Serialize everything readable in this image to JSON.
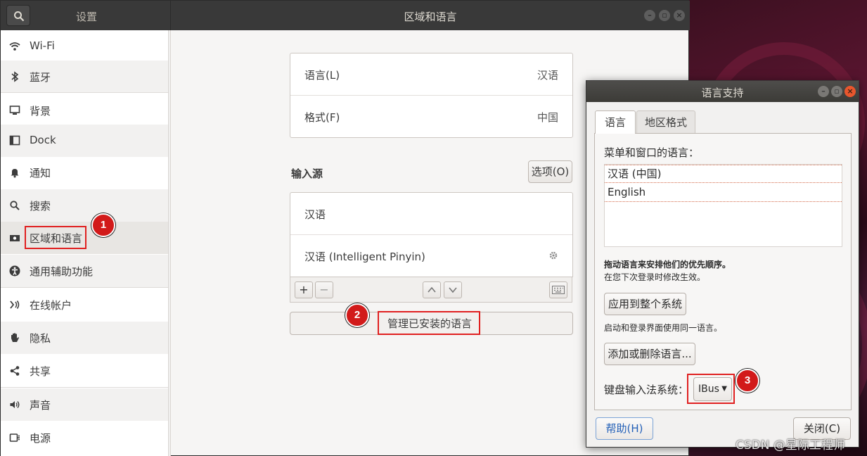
{
  "settings": {
    "app_title": "设置",
    "panel_title": "区域和语言",
    "sidebar": [
      {
        "label": "Wi-Fi",
        "icon": "wifi-icon"
      },
      {
        "label": "蓝牙",
        "icon": "bluetooth-icon"
      },
      {
        "label": "背景",
        "icon": "background-icon"
      },
      {
        "label": "Dock",
        "icon": "dock-icon"
      },
      {
        "label": "通知",
        "icon": "bell-icon"
      },
      {
        "label": "搜索",
        "icon": "search-icon"
      },
      {
        "label": "区域和语言",
        "icon": "flag-icon"
      },
      {
        "label": "通用辅助功能",
        "icon": "accessibility-icon"
      },
      {
        "label": "在线帐户",
        "icon": "online-accounts-icon"
      },
      {
        "label": "隐私",
        "icon": "hand-icon"
      },
      {
        "label": "共享",
        "icon": "share-icon"
      },
      {
        "label": "声音",
        "icon": "speaker-icon"
      },
      {
        "label": "电源",
        "icon": "power-icon"
      }
    ],
    "language_label": "语言(L)",
    "language_value": "汉语",
    "format_label": "格式(F)",
    "format_value": "中国",
    "input_sources_label": "输入源",
    "options_button": "选项(O)",
    "input_sources": [
      "汉语",
      "汉语 (Intelligent Pinyin)"
    ],
    "toolbar": {
      "add": "+",
      "remove": "−"
    },
    "manage_languages_button": "管理已安装的语言"
  },
  "dialog": {
    "title": "语言支持",
    "tabs": [
      "语言",
      "地区格式"
    ],
    "menu_lang_label": "菜单和窗口的语言：",
    "languages": [
      "汉语 (中国)",
      "English"
    ],
    "drag_hint": "拖动语言来安排他们的优先顺序。",
    "drag_hint2": "在您下次登录时修改生效。",
    "apply_button": "应用到整个系统",
    "apply_hint": "启动和登录界面使用同一语言。",
    "add_remove_button": "添加或删除语言...",
    "keyboard_label": "键盘输入法系统：",
    "keyboard_value": "IBus",
    "help_button": "帮助(H)",
    "close_button": "关闭(C)"
  },
  "annotations": [
    "1",
    "2",
    "3"
  ],
  "watermark": "CSDN @星际工程师",
  "colors": {
    "annotation_red": "#e02020",
    "titlebar": "#393939",
    "close_orange": "#e9562d"
  }
}
